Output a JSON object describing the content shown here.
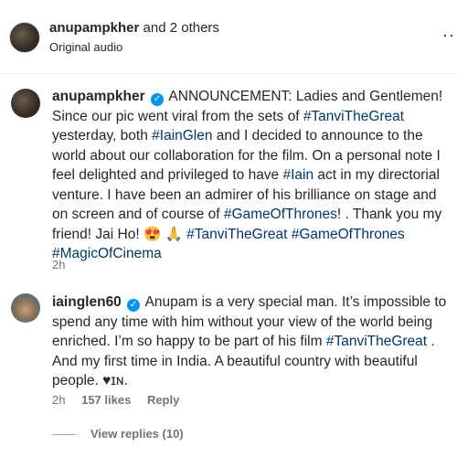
{
  "header": {
    "username": "anupampkher",
    "and_others": " and 2 others",
    "subtitle": "Original audio",
    "more_icon": "more-horizontal-icon"
  },
  "comments": [
    {
      "user": "anupampkher",
      "verified": true,
      "text_parts": [
        {
          "t": "ANNOUNCEMENT: Ladies and Gentlemen! Since our pic went viral from the sets of ",
          "tag": false
        },
        {
          "t": "#TanviTheGreat",
          "tag": true
        },
        {
          "t": " yesterday, both ",
          "tag": false
        },
        {
          "t": "#IainGlen",
          "tag": true
        },
        {
          "t": " and I decided to announce to the world about our collaboration for the film. On a personal note I feel delighted and privileged to have ",
          "tag": false
        },
        {
          "t": "#Iain",
          "tag": true
        },
        {
          "t": " act in my directorial venture. I have been an admirer of his brilliance on stage and on screen and of course of ",
          "tag": false
        },
        {
          "t": "#GameOfThrones",
          "tag": true
        },
        {
          "t": "! . Thank you my friend! Jai Ho! ",
          "tag": false
        },
        {
          "t": "😍 🙏 ",
          "tag": false
        },
        {
          "t": "#TanviTheGreat",
          "tag": true
        },
        {
          "t": " ",
          "tag": false
        },
        {
          "t": "#GameOfThrones",
          "tag": true
        },
        {
          "t": " ",
          "tag": false
        },
        {
          "t": "#MagicOfCinema",
          "tag": true
        }
      ],
      "time": "2h"
    },
    {
      "user": "iainglen60",
      "verified": true,
      "text_parts": [
        {
          "t": "Anupam is a very special man. It’s impossible to spend any time with him without your view of the world being enriched. I’m so happy to be part of his film ",
          "tag": false
        },
        {
          "t": "#TanviTheGreat",
          "tag": true
        },
        {
          "t": " . And my first time in India. A beautiful country with beautiful people. ♥ɪɴ.",
          "tag": false
        }
      ],
      "time": "2h",
      "likes": "157 likes",
      "reply": "Reply",
      "view_replies": "View replies (10)"
    }
  ],
  "colors": {
    "link": "#00376b",
    "verified": "#0095f6",
    "secondary": "#737373"
  }
}
